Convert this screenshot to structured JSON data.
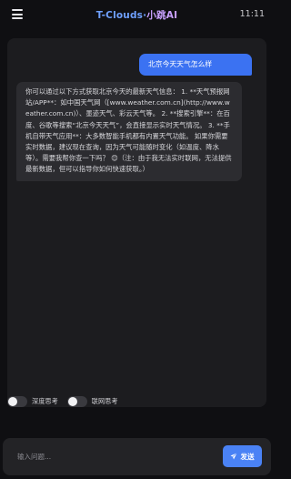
{
  "header": {
    "menu_icon": "hamburger-menu-icon",
    "title_part1": "T-Clouds",
    "title_sep": "·",
    "title_part2": "小跳AI",
    "time": "11:11"
  },
  "chat": {
    "messages": [
      {
        "role": "user",
        "text": "北京今天天气怎么样"
      },
      {
        "role": "assistant",
        "text": "你可以通过以下方式获取北京今天的最新天气信息： 1. **天气预报网站/APP**：如中国天气网（[www.weather.com.cn](http://www.weather.com.cn)）、墨迹天气、彩云天气等。 2. **搜索引擎**：在百度、谷歌等搜索“北京今天天气”，会直接显示实时天气情况。 3. **手机自带天气应用**：大多数智能手机都有内置天气功能。 如果你需要实时数据，建议现在查询，因为天气可能随时变化（如温度、降水等）。需要我帮你查一下吗？ 😊（注：由于我无法实时联网，无法提供最新数据，但可以指导你如何快速获取。）"
      }
    ]
  },
  "toggles": [
    {
      "label": "深度思考",
      "on": false
    },
    {
      "label": "联网思考",
      "on": false
    }
  ],
  "input": {
    "placeholder": "输入问题...",
    "value": ""
  },
  "send_button": {
    "label": "发送",
    "icon": "paper-plane-icon"
  },
  "colors": {
    "accent": "#4a82f5",
    "user_bubble": "#3b72f2",
    "title_blue": "#6fa0ff",
    "title_purple": "#c9a0ff"
  }
}
